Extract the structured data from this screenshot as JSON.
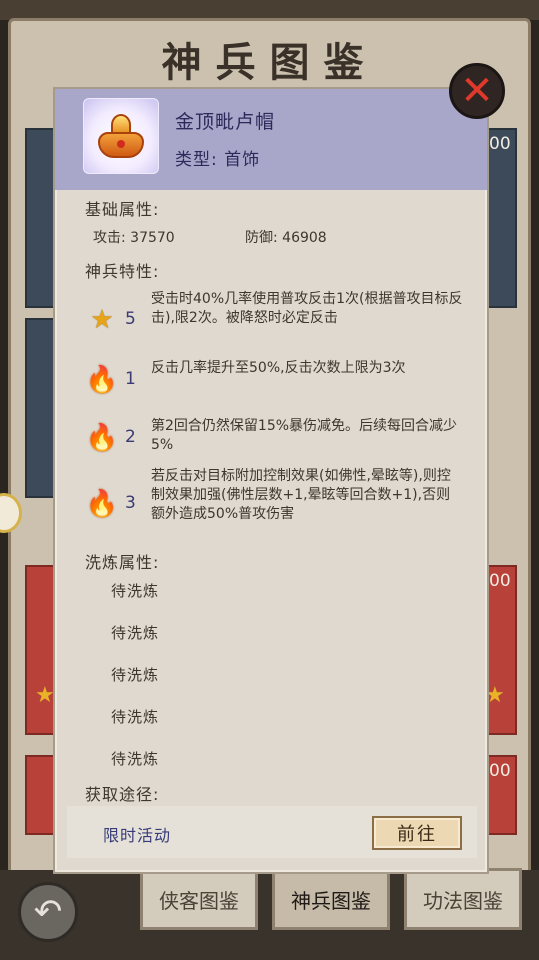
{
  "background": {
    "title": "神兵图鉴",
    "side_numbers": [
      "00",
      "00",
      "00"
    ],
    "tabs": [
      {
        "label": "侠客图鉴"
      },
      {
        "label": "神兵图鉴"
      },
      {
        "label": "功法图鉴"
      }
    ]
  },
  "panel": {
    "item": {
      "name": "金顶毗卢帽",
      "type": "类型: 首饰"
    },
    "base_attr": {
      "title": "基础属性:",
      "attack": "攻击: 37570",
      "defense": "防御: 46908"
    },
    "traits": {
      "title": "神兵特性:",
      "items": [
        {
          "icon": "star-icon",
          "level": "5",
          "text": "受击时40%几率使用普攻反击1次(根据普攻目标反击),限2次。被降怒时必定反击"
        },
        {
          "icon": "flame-icon",
          "level": "1",
          "text": "反击几率提升至50%,反击次数上限为3次"
        },
        {
          "icon": "flame-icon",
          "level": "2",
          "text": "第2回合仍然保留15%暴伤减免。后续每回合减少5%"
        },
        {
          "icon": "flame-icon",
          "level": "3",
          "text": "若反击对目标附加控制效果(如佛性,晕眩等),则控制效果加强(佛性层数+1,晕眩等回合数+1),否则额外造成50%普攻伤害"
        }
      ]
    },
    "refine": {
      "title": "洗炼属性:",
      "items": [
        "待洗炼",
        "待洗炼",
        "待洗炼",
        "待洗炼",
        "待洗炼"
      ]
    },
    "source": {
      "title": "获取途径:",
      "label": "限时活动",
      "goto": "前往"
    }
  },
  "colors": {
    "header_bg": "#a8a7c9",
    "panel_bg": "#dfd9cf",
    "accent_text": "#2c2a5a",
    "close_x": "#e0392c"
  }
}
